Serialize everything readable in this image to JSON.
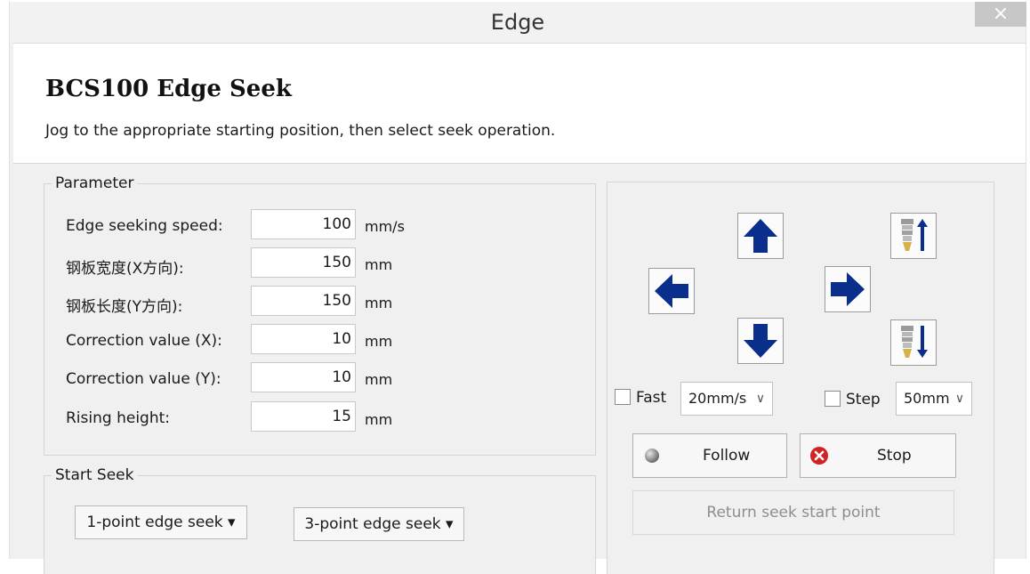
{
  "window": {
    "title": "Edge",
    "close_glyph": "×"
  },
  "header": {
    "title": "BCS100 Edge Seek",
    "description": "Jog to the appropriate starting position, then select seek operation."
  },
  "parameter": {
    "group_label": "Parameter",
    "rows": [
      {
        "label": "Edge seeking speed:",
        "value": "100",
        "unit": "mm/s"
      },
      {
        "label": "钢板宽度(X方向):",
        "value": "150",
        "unit": "mm"
      },
      {
        "label": "钢板长度(Y方向):",
        "value": "150",
        "unit": "mm"
      },
      {
        "label": "Correction value (X):",
        "value": "10",
        "unit": "mm"
      },
      {
        "label": "Correction value (Y):",
        "value": "10",
        "unit": "mm"
      },
      {
        "label": "Rising height:",
        "value": "15",
        "unit": "mm"
      }
    ]
  },
  "start_seek": {
    "group_label": "Start Seek",
    "one_point_label": "1-point edge seek ▾",
    "three_point_label": "3-point edge seek ▾"
  },
  "jog": {
    "icons": [
      "arrow-up-icon",
      "arrow-down-icon",
      "arrow-left-icon",
      "arrow-right-icon",
      "torch-up-icon",
      "torch-down-icon"
    ],
    "fast_label": "Fast",
    "fast_checked": false,
    "speed_value": "20mm/s",
    "step_label": "Step",
    "step_checked": false,
    "step_value": "50mm",
    "follow_label": "Follow",
    "stop_label": "Stop",
    "return_label": "Return seek start point"
  },
  "colors": {
    "arrow_blue": "#0a2e8c",
    "stop_red": "#d42222",
    "follow_gray": "#8a8a8a"
  }
}
